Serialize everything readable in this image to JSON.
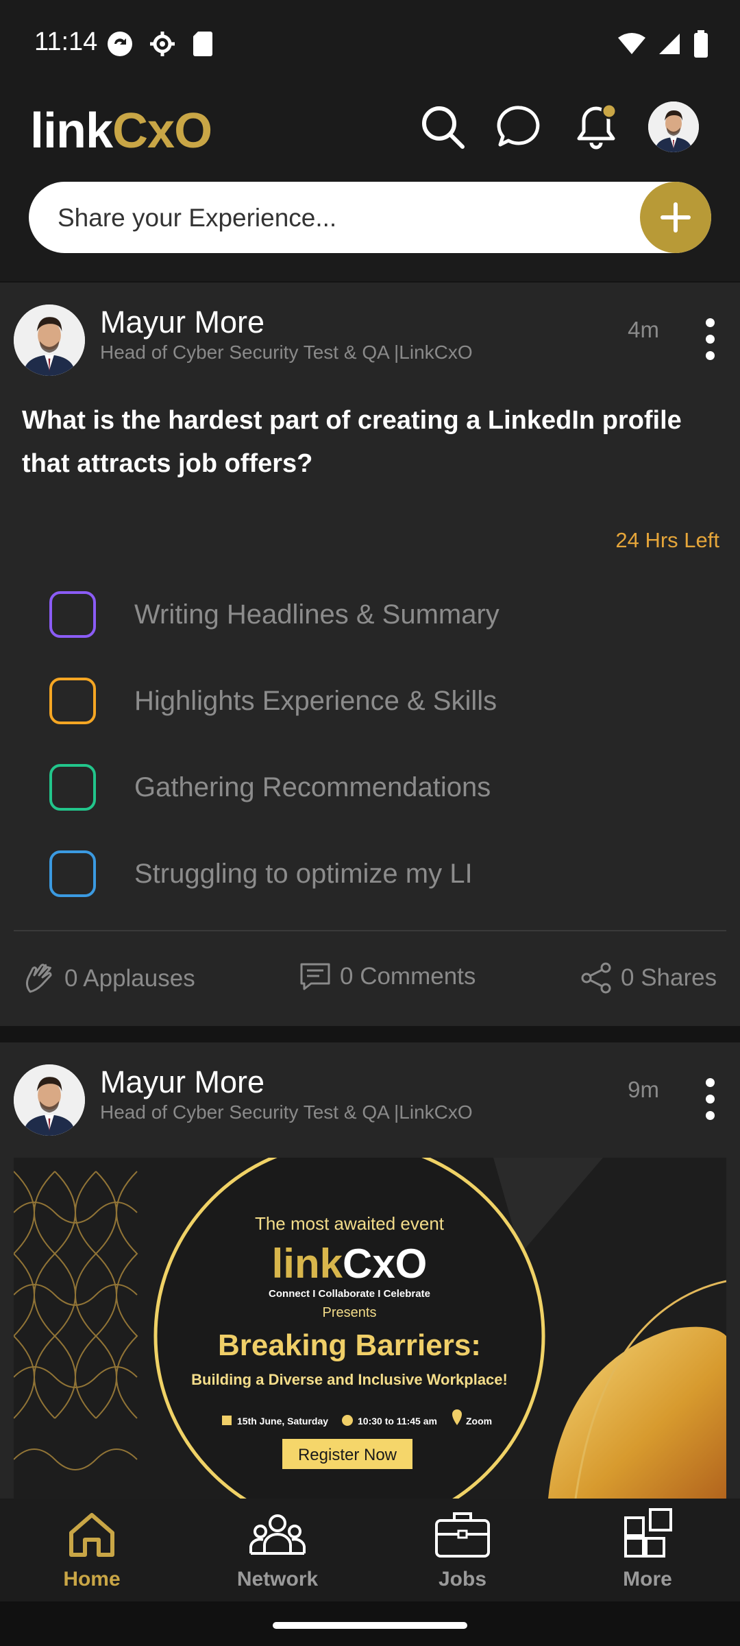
{
  "status_bar": {
    "time": "11:14"
  },
  "header": {
    "logo_link": "link",
    "logo_cxo": "CxO",
    "share_placeholder": "Share your Experience...",
    "accent": "#c9a646",
    "notification_dot_color": "#c9a646"
  },
  "posts": [
    {
      "author": "Mayur More",
      "title": "Head of Cyber Security Test & QA |LinkCxO",
      "time": "4m",
      "question": "What is the hardest part of creating a LinkedIn profile that attracts job offers?",
      "time_left": "24 Hrs Left",
      "options": [
        {
          "label": "Writing Headlines & Summary",
          "color": "#8b5cf6"
        },
        {
          "label": "Highlights Experience & Skills",
          "color": "#f5a623"
        },
        {
          "label": "Gathering Recommendations",
          "color": "#22c58b"
        },
        {
          "label": "Struggling to optimize my LI",
          "color": "#3b9ae1"
        }
      ],
      "stats": {
        "applauses": "0 Applauses",
        "comments": "0 Comments",
        "shares": "0 Shares"
      }
    },
    {
      "author": "Mayur More",
      "title": "Head of Cyber Security Test & QA |LinkCxO",
      "time": "9m",
      "banner": {
        "line1": "The most awaited event",
        "logo_link": "link",
        "logo_cxo": "CxO",
        "tagline": "Connect I Collaborate I Celebrate",
        "presents": "Presents",
        "headline": "Breaking Barriers:",
        "subheadline": "Building a Diverse and Inclusive Workplace!",
        "date": "15th June, Saturday",
        "time": "10:30 to 11:45 am",
        "venue": "Zoom",
        "cta": "Register Now"
      }
    }
  ],
  "bottom_nav": [
    {
      "label": "Home",
      "active": true
    },
    {
      "label": "Network",
      "active": false
    },
    {
      "label": "Jobs",
      "active": false
    },
    {
      "label": "More",
      "active": false
    }
  ]
}
